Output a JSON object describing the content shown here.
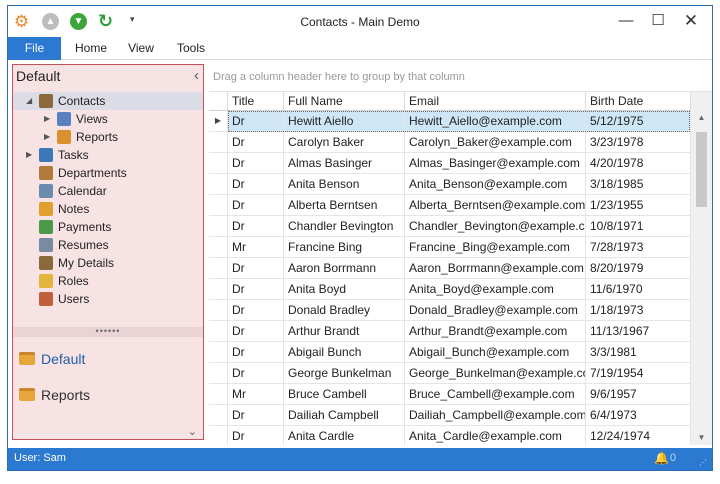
{
  "window": {
    "title": "Contacts - Main Demo"
  },
  "toolbar": {
    "qat_menu": "▾"
  },
  "ribbon": {
    "tabs": [
      {
        "label": "File"
      },
      {
        "label": "Home"
      },
      {
        "label": "View"
      },
      {
        "label": "Tools"
      }
    ]
  },
  "navigation": {
    "header": "Default",
    "items": [
      {
        "label": "Contacts",
        "icon": "contacts-icon",
        "color": "#8a6a3b"
      },
      {
        "label": "Views",
        "icon": "views-icon",
        "color": "#5a7fbf"
      },
      {
        "label": "Reports",
        "icon": "reports-icon",
        "color": "#d9902f"
      },
      {
        "label": "Tasks",
        "icon": "tasks-icon",
        "color": "#3a78b8"
      },
      {
        "label": "Departments",
        "icon": "departments-icon",
        "color": "#b07a3a"
      },
      {
        "label": "Calendar",
        "icon": "calendar-icon",
        "color": "#6b8cae"
      },
      {
        "label": "Notes",
        "icon": "notes-icon",
        "color": "#e0a030"
      },
      {
        "label": "Payments",
        "icon": "payments-icon",
        "color": "#4a9a4a"
      },
      {
        "label": "Resumes",
        "icon": "resumes-icon",
        "color": "#7a8aa0"
      },
      {
        "label": "My Details",
        "icon": "my-details-icon",
        "color": "#8a6a3b"
      },
      {
        "label": "Roles",
        "icon": "roles-icon",
        "color": "#e3b53a"
      },
      {
        "label": "Users",
        "icon": "users-icon",
        "color": "#c0603a"
      }
    ],
    "splitter": "••••••",
    "groups": [
      {
        "label": "Default",
        "color": "#1f5fa8"
      },
      {
        "label": "Reports",
        "color": "#333333"
      }
    ]
  },
  "grid": {
    "group_hint": "Drag a column header here to group by that column",
    "columns": [
      "Title",
      "Full Name",
      "Email",
      "Birth Date"
    ],
    "rows": [
      [
        "Dr",
        "Hewitt Aiello",
        "Hewitt_Aiello@example.com",
        "5/12/1975"
      ],
      [
        "Dr",
        "Carolyn Baker",
        "Carolyn_Baker@example.com",
        "3/23/1978"
      ],
      [
        "Dr",
        "Almas Basinger",
        "Almas_Basinger@example.com",
        "4/20/1978"
      ],
      [
        "Dr",
        "Anita Benson",
        "Anita_Benson@example.com",
        "3/18/1985"
      ],
      [
        "Dr",
        "Alberta Berntsen",
        "Alberta_Berntsen@example.com",
        "1/23/1955"
      ],
      [
        "Dr",
        "Chandler Bevington",
        "Chandler_Bevington@example.com",
        "10/8/1971"
      ],
      [
        "Mr",
        "Francine Bing",
        "Francine_Bing@example.com",
        "7/28/1973"
      ],
      [
        "Dr",
        "Aaron Borrmann",
        "Aaron_Borrmann@example.com",
        "8/20/1979"
      ],
      [
        "Dr",
        "Anita Boyd",
        "Anita_Boyd@example.com",
        "11/6/1970"
      ],
      [
        "Dr",
        "Donald Bradley",
        "Donald_Bradley@example.com",
        "1/18/1973"
      ],
      [
        "Dr",
        "Arthur Brandt",
        "Arthur_Brandt@example.com",
        "11/13/1967"
      ],
      [
        "Dr",
        "Abigail Bunch",
        "Abigail_Bunch@example.com",
        "3/3/1981"
      ],
      [
        "Dr",
        "George Bunkelman",
        "George_Bunkelman@example.com",
        "7/19/1954"
      ],
      [
        "Mr",
        "Bruce Cambell",
        "Bruce_Cambell@example.com",
        "9/6/1957"
      ],
      [
        "Dr",
        "Dailiah Campbell",
        "Dailiah_Campbell@example.com",
        "6/4/1973"
      ],
      [
        "Dr",
        "Anita Cardle",
        "Anita_Cardle@example.com",
        "12/24/1974"
      ]
    ],
    "selected_row": 0
  },
  "status": {
    "user": "User: Sam",
    "notifications": "0"
  },
  "colors": {
    "accent": "#2b79d0",
    "nav_bg": "#f7e3e4",
    "nav_border": "#c0505b",
    "selection": "#cfe6f7"
  }
}
